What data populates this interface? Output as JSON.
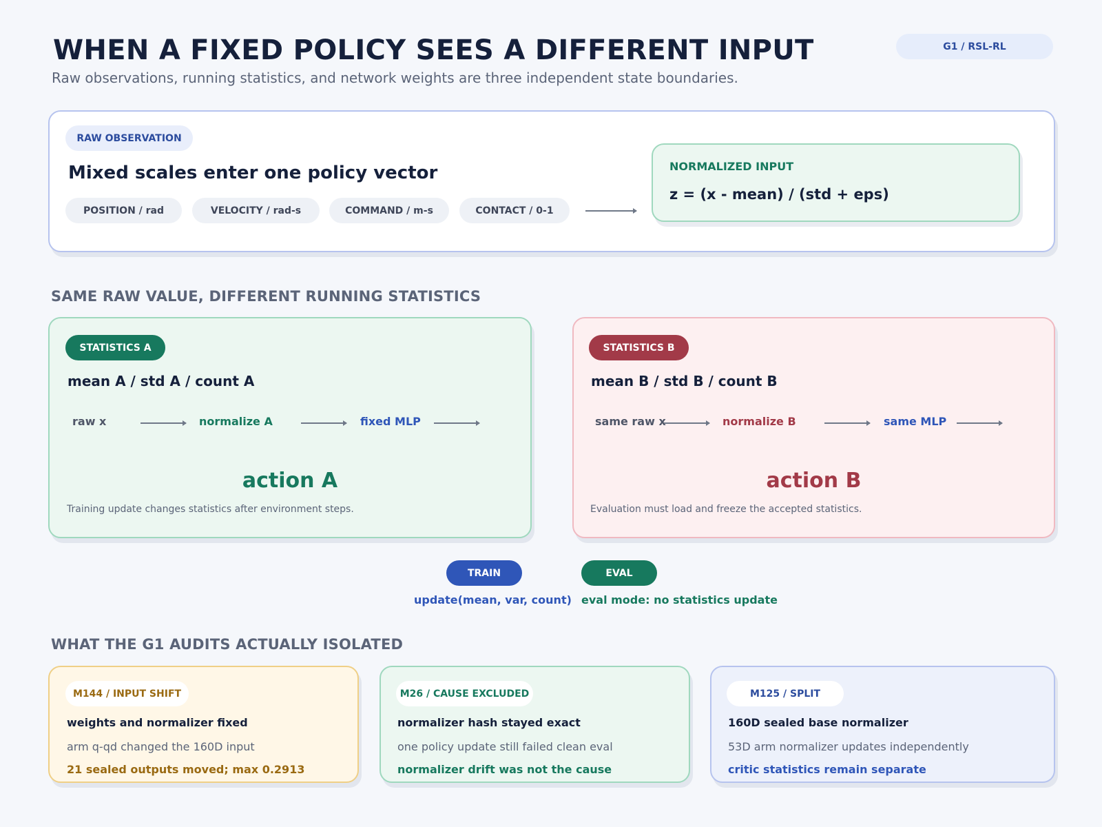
{
  "header": {
    "title": "WHEN A FIXED POLICY SEES A DIFFERENT INPUT",
    "subtitle": "Raw observations, running statistics, and network weights are three independent state boundaries.",
    "badge": "G1 / RSL-RL"
  },
  "raw_observation": {
    "badge": "RAW OBSERVATION",
    "heading": "Mixed scales enter one policy vector",
    "chips": [
      "POSITION / rad",
      "VELOCITY / rad-s",
      "COMMAND / m-s",
      "CONTACT / 0-1"
    ],
    "normalized": {
      "label": "NORMALIZED INPUT",
      "formula": "z = (x - mean) / (std + eps)"
    }
  },
  "running_stats": {
    "section_title": "SAME RAW VALUE, DIFFERENT RUNNING STATISTICS",
    "a": {
      "badge": "STATISTICS A",
      "heading": "mean A / std A / count A",
      "flow": [
        "raw x",
        "normalize A",
        "fixed MLP"
      ],
      "action": "action A",
      "note": "Training update changes statistics after environment steps."
    },
    "b": {
      "badge": "STATISTICS B",
      "heading": "mean B / std B / count B",
      "flow": [
        "same raw x",
        "normalize B",
        "same MLP"
      ],
      "action": "action B",
      "note": "Evaluation must load and freeze the accepted statistics."
    }
  },
  "modes": {
    "train": {
      "label": "TRAIN",
      "caption": "update(mean, var, count)"
    },
    "eval": {
      "label": "EVAL",
      "caption": "eval mode: no statistics update"
    }
  },
  "audits": {
    "section_title": "WHAT THE G1 AUDITS ACTUALLY ISOLATED",
    "cards": [
      {
        "badge": "M144 / INPUT SHIFT",
        "line1": "weights and normalizer fixed",
        "line2": "arm q-qd changed the 160D input",
        "line3": "21 sealed outputs moved; max 0.2913"
      },
      {
        "badge": "M26 / CAUSE EXCLUDED",
        "line1": "normalizer hash stayed exact",
        "line2": "one policy update still failed clean eval",
        "line3": "normalizer drift was not the cause"
      },
      {
        "badge": "M125 / SPLIT",
        "line1": "160D sealed base normalizer",
        "line2": "53D arm normalizer updates independently",
        "line3": "critic statistics remain separate"
      }
    ]
  },
  "colors": {
    "green": "#17795e",
    "red": "#a23a48",
    "blue": "#2f56b8",
    "amber": "#9a6a12"
  }
}
